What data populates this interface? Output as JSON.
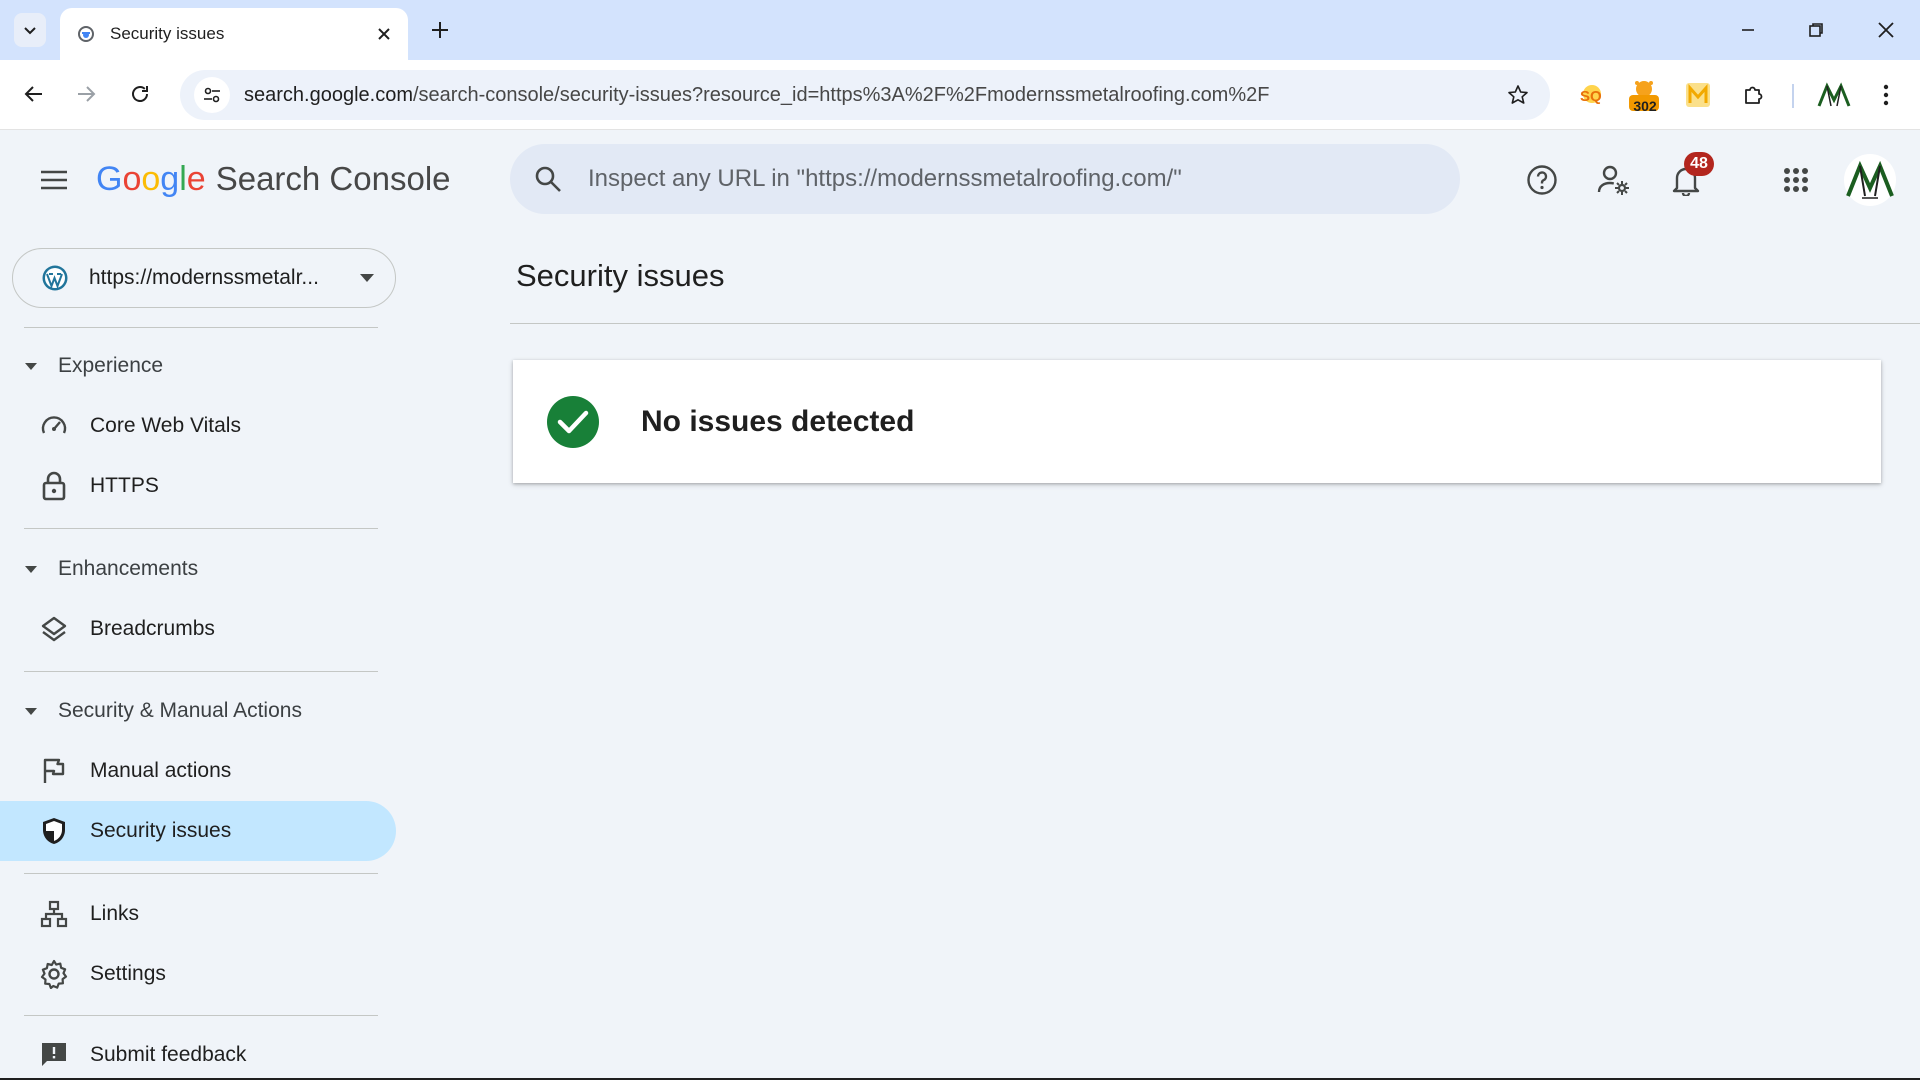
{
  "browser": {
    "tab_title": "Security issues",
    "url_host": "search.google.com",
    "url_path": "/search-console/security-issues?resource_id=https%3A%2F%2Fmodernssmetalroofing.com%2F",
    "extension_badge": "302"
  },
  "header": {
    "brand_google": [
      "G",
      "o",
      "o",
      "g",
      "l",
      "e"
    ],
    "brand_colors": [
      "#4285F4",
      "#EA4335",
      "#FBBC05",
      "#4285F4",
      "#34A853",
      "#EA4335"
    ],
    "product": "Search Console",
    "inspect_placeholder": "Inspect any URL in \"https://modernssmetalroofing.com/\"",
    "notification_count": "48"
  },
  "sidebar": {
    "property": "https://modernssmetalr...",
    "sections": [
      {
        "label": "Experience",
        "items": [
          "Core Web Vitals",
          "HTTPS"
        ]
      },
      {
        "label": "Enhancements",
        "items": [
          "Breadcrumbs"
        ]
      },
      {
        "label": "Security & Manual Actions",
        "items": [
          "Manual actions",
          "Security issues"
        ]
      }
    ],
    "links": "Links",
    "settings": "Settings",
    "feedback": "Submit feedback",
    "active_item": "Security issues"
  },
  "main": {
    "title": "Security issues",
    "status": "No issues detected",
    "status_color": "#188038"
  },
  "colors": {
    "accent": "#c2e7ff",
    "tabstrip": "#d3e3fd",
    "background": "#f0f4f9"
  }
}
